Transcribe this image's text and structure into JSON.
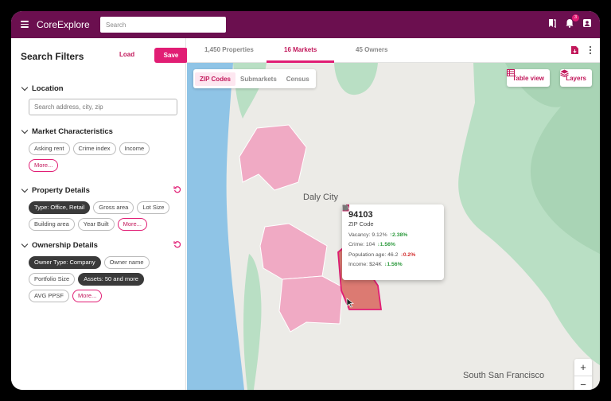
{
  "app": {
    "title": "CoreExplore"
  },
  "search": {
    "placeholder": "Search"
  },
  "notifications": {
    "count": "3"
  },
  "filters": {
    "title": "Search Filters",
    "load_label": "Load",
    "save_label": "Save",
    "location": {
      "title": "Location",
      "placeholder": "Search address, city, zip"
    },
    "market": {
      "title": "Market Characteristics",
      "chips": [
        "Asking rent",
        "Crime index",
        "Income"
      ],
      "more": "More..."
    },
    "property": {
      "title": "Property Details",
      "chips": [
        "Type: Office, Retail",
        "Gross area",
        "Lot Size",
        "Building area",
        "Year Built"
      ],
      "more": "More..."
    },
    "ownership": {
      "title": "Ownership Details",
      "chips": [
        "Owner Type: Company",
        "Owner name",
        "Portfolio Size",
        "Assets: 50 and more",
        "AVG PPSF"
      ],
      "more": "More..."
    }
  },
  "tabs": [
    {
      "label": "1,450 Properties"
    },
    {
      "label": "16 Markets"
    },
    {
      "label": "45 Owners"
    }
  ],
  "map": {
    "segments": [
      "ZIP Codes",
      "Submarkets",
      "Census"
    ],
    "table_view": "Table view",
    "layers": "Layers",
    "cities": {
      "daly": "Daly City",
      "ssf": "South San Francisco"
    },
    "zoom_in": "+",
    "zoom_out": "−"
  },
  "popup": {
    "zip": "94103",
    "type": "ZIP Code",
    "rows": [
      {
        "label": "Vacancy: 9.12%",
        "change": "2.38%",
        "dir": "up"
      },
      {
        "label": "Crime: 104",
        "change": "1.56%",
        "dir": "down"
      },
      {
        "label": "Population age: 46.2",
        "change": "0.2%",
        "dir": "down"
      },
      {
        "label": "Income: $24K",
        "change": "1.56%",
        "dir": "down"
      }
    ]
  },
  "colors": {
    "brand": "#6b0f4f",
    "accent": "#e11d74",
    "water": "#8fc4e6",
    "park": "#b9dfc4",
    "zone": "#f0aac4",
    "zone_selected": "#dc7a72"
  }
}
